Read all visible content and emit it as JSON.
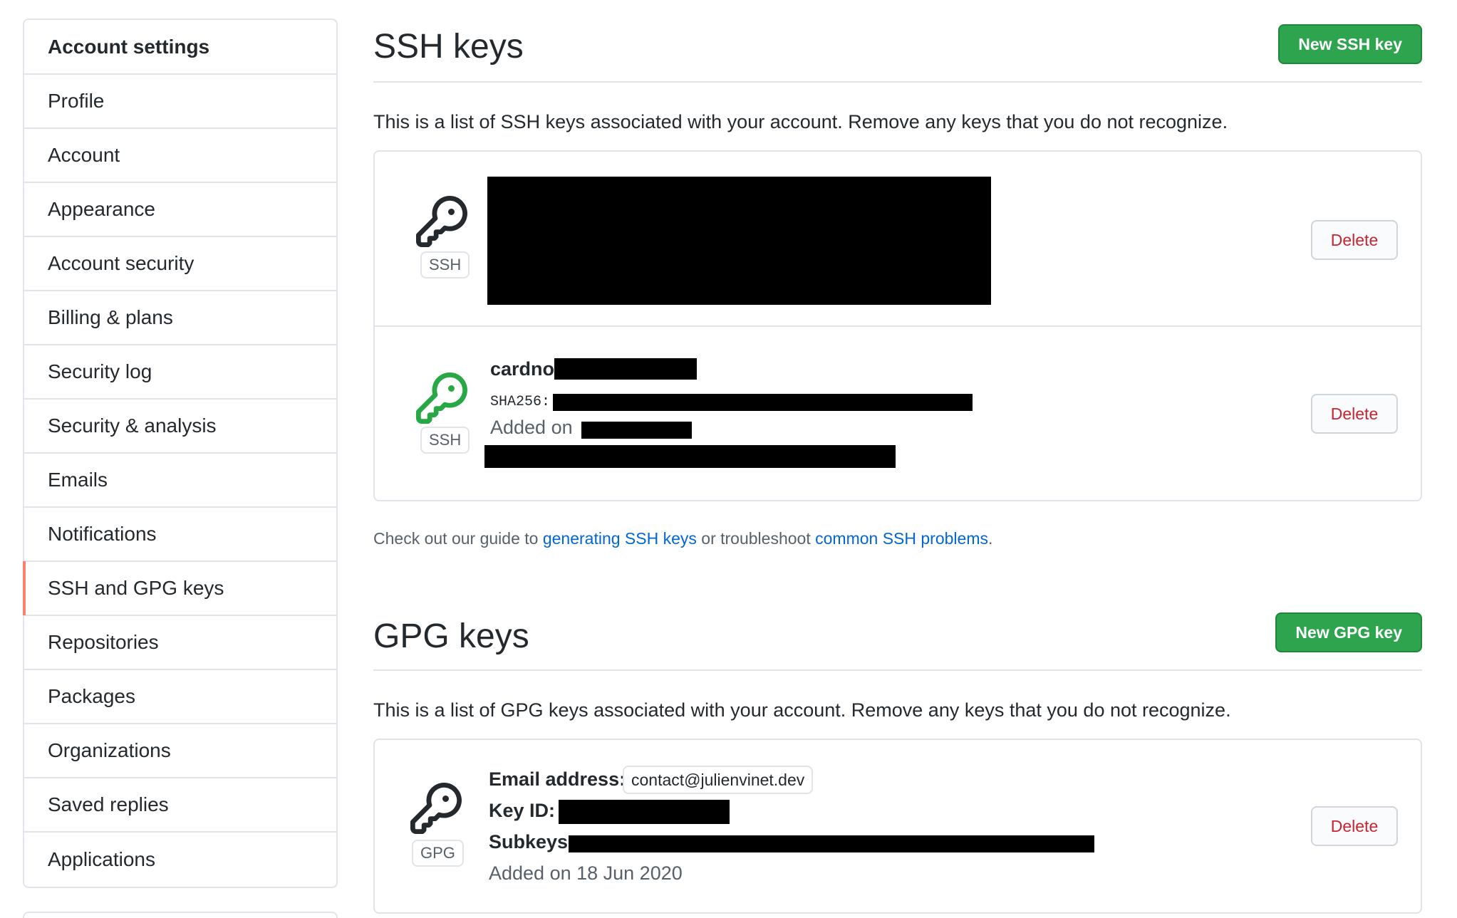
{
  "sidebar": {
    "header": "Account settings",
    "items": [
      {
        "label": "Profile"
      },
      {
        "label": "Account"
      },
      {
        "label": "Appearance"
      },
      {
        "label": "Account security"
      },
      {
        "label": "Billing & plans"
      },
      {
        "label": "Security log"
      },
      {
        "label": "Security & analysis"
      },
      {
        "label": "Emails"
      },
      {
        "label": "Notifications"
      },
      {
        "label": "SSH and GPG keys",
        "selected": true
      },
      {
        "label": "Repositories"
      },
      {
        "label": "Packages"
      },
      {
        "label": "Organizations"
      },
      {
        "label": "Saved replies"
      },
      {
        "label": "Applications"
      }
    ]
  },
  "ssh": {
    "title": "SSH keys",
    "new_button": "New SSH key",
    "description": "This is a list of SSH keys associated with your account. Remove any keys that you do not recognize.",
    "keys": [
      {
        "type": "SSH",
        "icon": "key-icon",
        "icon_color": "#24292e",
        "delete_label": "Delete",
        "redacted": true
      },
      {
        "type": "SSH",
        "icon": "key-icon",
        "icon_color": "#28a745",
        "title_prefix": "cardno:",
        "fingerprint_prefix": "SHA256:",
        "added_prefix": "Added on",
        "delete_label": "Delete"
      }
    ],
    "guide": {
      "prefix": "Check out our guide to ",
      "link1": "generating SSH keys",
      "middle": " or troubleshoot ",
      "link2": "common SSH problems",
      "suffix": "."
    }
  },
  "gpg": {
    "title": "GPG keys",
    "new_button": "New GPG key",
    "description": "This is a list of GPG keys associated with your account. Remove any keys that you do not recognize.",
    "keys": [
      {
        "type": "GPG",
        "icon": "key-icon",
        "icon_color": "#24292e",
        "email_label": "Email address:",
        "email": "contact@julienvinet.dev",
        "keyid_label": "Key ID:",
        "subkeys_label": "Subkeys:",
        "added": "Added on 18 Jun 2020",
        "delete_label": "Delete"
      }
    ]
  },
  "colors": {
    "accent": "#f9826c",
    "primary_button": "#2ea44f",
    "danger": "#cb2431",
    "link": "#0366d6"
  }
}
